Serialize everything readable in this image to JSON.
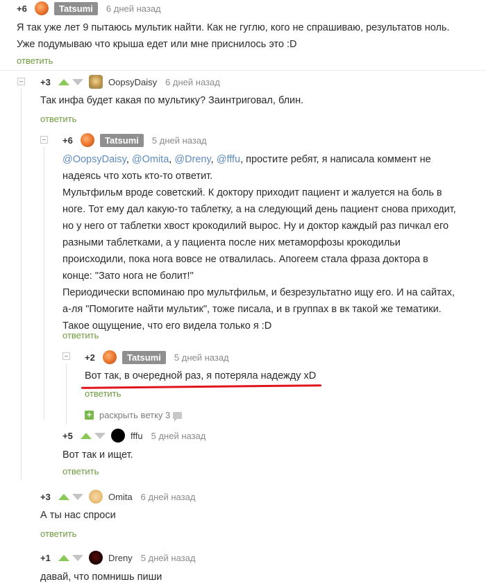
{
  "comments": {
    "c1": {
      "rating": "+6",
      "author": "Tatsumi",
      "time": "6 дней назад",
      "lines": [
        "Я так уже лет 9 пытаюсь мультик найти. Как не гуглю, кого не спрашиваю, результатов ноль.",
        "Уже подумываю что крыша едет или мне приснилось это :D"
      ],
      "reply": "ответить"
    },
    "c2": {
      "rating": "+3",
      "author": "OopsyDaisy",
      "time": "6 дней назад",
      "lines": [
        "Так инфа будет какая по мультику? Заинтриговал, блин."
      ],
      "reply": "ответить"
    },
    "c3": {
      "rating": "+6",
      "author": "Tatsumi",
      "time": "5 дней назад",
      "mentions": [
        "@OopsyDaisy",
        "@Omita",
        "@Dreny",
        "@fffu"
      ],
      "line1_rest": ", простите ребят, я написала коммент не",
      "lines": [
        "надеясь что хоть кто-то ответит.",
        "Мультфильм вроде советский. К доктору приходит пациент и жалуется на боль в",
        "ноге. Тот ему дал какую-то таблетку, а на следующий день пациент снова приходит,",
        "но у него от таблетки хвост крокодилий вырос. Ну и доктор каждый раз пичкал его",
        "разными таблетками, а у пациента после них метаморфозы крокодильи",
        "происходили, пока нога вовсе не отвалилась. Апогеем стала фраза доктора в",
        "конце: \"Зато нога не болит!\"",
        "Периодически вспоминаю про мультфильм, и безрезультатно ищу его. И на сайтах,",
        "а-ля \"Помогите найти мультик\", тоже писала, и в группах в вк такой же тематики.",
        "Такое ощущение, что его видела только я :D"
      ],
      "reply": "ответить"
    },
    "c4": {
      "rating": "+2",
      "author": "Tatsumi",
      "time": "5 дней назад",
      "lines": [
        "Вот так, в очередной раз, я потеряла надежду xD"
      ],
      "reply": "ответить",
      "expand": "раскрыть ветку 3"
    },
    "c5": {
      "rating": "+5",
      "author": "fffu",
      "time": "5 дней назад",
      "lines": [
        "Вот так и ищет."
      ],
      "reply": "ответить"
    },
    "c6": {
      "rating": "+3",
      "author": "Omita",
      "time": "6 дней назад",
      "lines": [
        "А ты нас спроси"
      ],
      "reply": "ответить"
    },
    "c7": {
      "rating": "+1",
      "author": "Dreny",
      "time": "5 дней назад",
      "lines": [
        "давай, что помнишь пиши"
      ]
    }
  },
  "colors": {
    "upvote": "#8ac858",
    "link": "#6e9c3d",
    "mention": "#5e8bc0",
    "highlight": "#e0141d"
  },
  "icons": [
    "upvote-arrow-icon",
    "downvote-arrow-icon",
    "collapse-icon",
    "plus-icon",
    "comment-icon"
  ]
}
